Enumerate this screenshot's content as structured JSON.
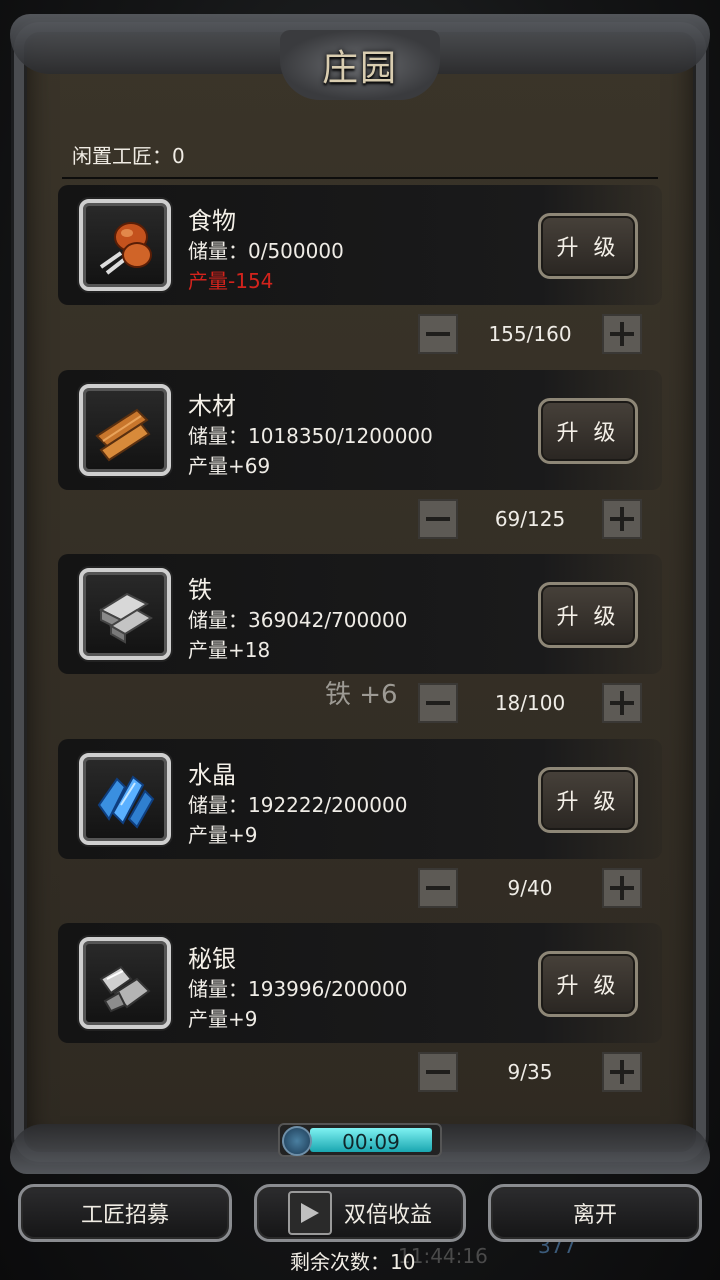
{
  "title": "庄园",
  "idle_label": "闲置工匠：0",
  "upgrade_label": "升 级",
  "resources": [
    {
      "name": "食物",
      "storage": "储量：0/500000",
      "production": "产量-154",
      "count": "155/160",
      "icon": "meat-icon"
    },
    {
      "name": "木材",
      "storage": "储量：1018350/1200000",
      "production": "产量+69",
      "count": "69/125",
      "icon": "wood-planks-icon"
    },
    {
      "name": "铁",
      "storage": "储量：369042/700000",
      "production": "产量+18",
      "count": "18/100",
      "icon": "iron-ingot-icon"
    },
    {
      "name": "水晶",
      "storage": "储量：192222/200000",
      "production": "产量+9",
      "count": "9/40",
      "icon": "crystal-icon"
    },
    {
      "name": "秘银",
      "storage": "储量：193996/200000",
      "production": "产量+9",
      "count": "9/35",
      "icon": "mithril-ore-icon"
    }
  ],
  "floating_text": "铁 +6",
  "timer": "00:09",
  "buttons": {
    "recruit": "工匠招募",
    "double": "双倍收益",
    "leave": "离开"
  },
  "remaining": "剩余次数：10",
  "background": {
    "clock": "11:44:16",
    "gems": "377"
  },
  "colors": {
    "negative": "#d3231c",
    "timer_fill": "#2fc6cc"
  }
}
